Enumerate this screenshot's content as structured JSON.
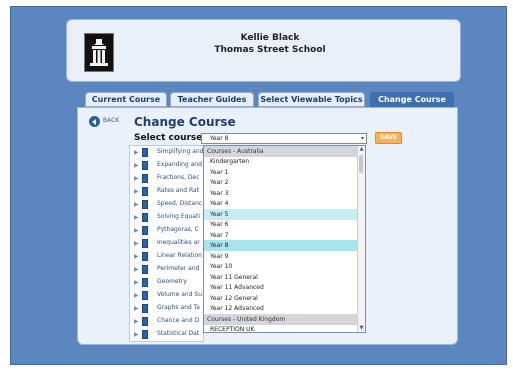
{
  "header": {
    "name": "Kellie Black",
    "school": "Thomas Street School"
  },
  "tabs": [
    {
      "label": "Current Course"
    },
    {
      "label": "Teacher Guides"
    },
    {
      "label": "Select Viewable Topics"
    },
    {
      "label": "Change Course",
      "active": true
    }
  ],
  "panel": {
    "back_label": "BACK",
    "title": "Change Course",
    "select_label": "Select course:",
    "select_value": "Year 8",
    "save_label": "SAVE"
  },
  "topics": [
    "Simplifying and",
    "Expanding and",
    "Fractions, Dec",
    "Rates and Rat",
    "Speed, Distanc",
    "Solving Equati",
    "Pythagoras, C",
    "Inequalities ar",
    "Linear Relation",
    "Perimeter and",
    "Geometry",
    "Volume and Su",
    "Graphs and Ta",
    "Chance and D",
    "Statistical Dat"
  ],
  "dropdown": {
    "options": [
      {
        "label": "Courses - Australia",
        "group": true
      },
      {
        "label": "Kindergarten"
      },
      {
        "label": "Year 1"
      },
      {
        "label": "Year 2"
      },
      {
        "label": "Year 3"
      },
      {
        "label": "Year 4"
      },
      {
        "label": "Year 5",
        "highlight": true
      },
      {
        "label": "Year 6"
      },
      {
        "label": "Year 7"
      },
      {
        "label": "Year 8",
        "selected": true
      },
      {
        "label": "Year 9"
      },
      {
        "label": "Year 10"
      },
      {
        "label": "Year 11 General"
      },
      {
        "label": "Year 11 Advanced"
      },
      {
        "label": "Year 12 General"
      },
      {
        "label": "Year 12 Advanced"
      },
      {
        "label": "Courses - United Kingdom",
        "group": true
      },
      {
        "label": "RECEPTION UK"
      }
    ]
  },
  "colors": {
    "frame": "#5b86bf",
    "tab_active": "#3f6fae",
    "save": "#f7b05f",
    "selected_option": "#a8e4ec"
  }
}
